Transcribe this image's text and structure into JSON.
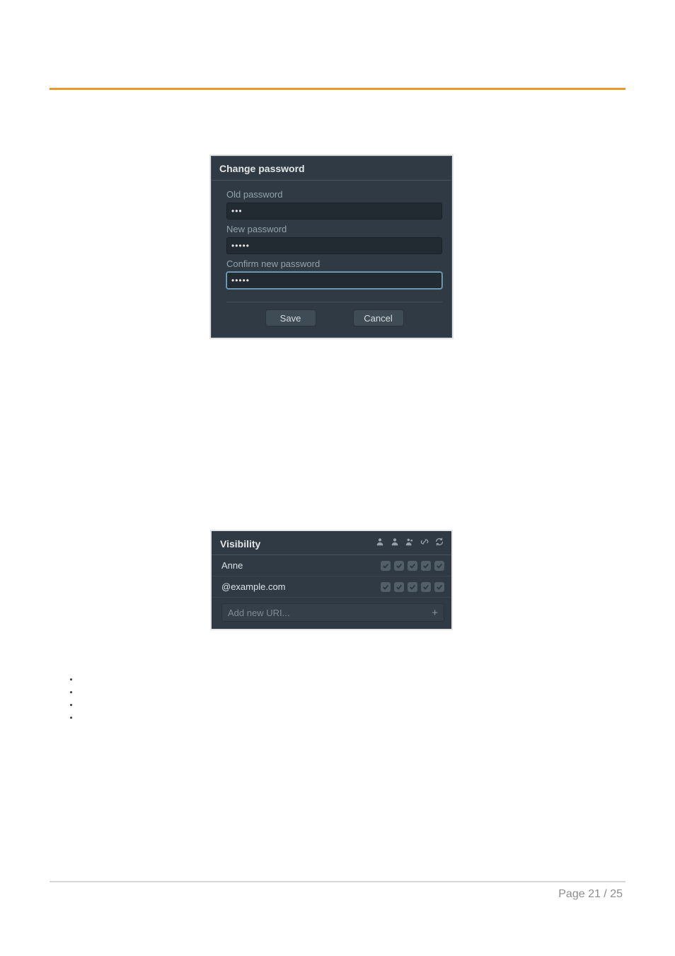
{
  "change_password": {
    "title": "Change password",
    "old_label": "Old password",
    "old_value": "•••",
    "new_label": "New password",
    "new_value": "•••••",
    "confirm_label": "Confirm new password",
    "confirm_value": "•••••",
    "save": "Save",
    "cancel": "Cancel"
  },
  "visibility": {
    "title": "Visibility",
    "rows": [
      {
        "label": "Anne"
      },
      {
        "label": "@example.com"
      }
    ],
    "add_placeholder": "Add new URI...",
    "plus": "+"
  },
  "footer": {
    "text": "Page 21 / 25"
  }
}
